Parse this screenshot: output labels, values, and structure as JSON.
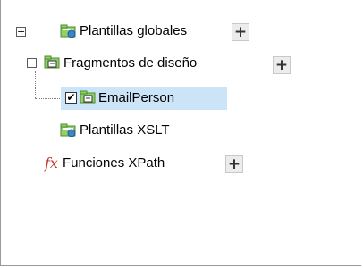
{
  "tree": {
    "nodes": [
      {
        "label": "Plantillas globales",
        "expander": "+",
        "has_add": true
      },
      {
        "label": "Fragmentos de diseño",
        "expander": "−",
        "has_add": true
      },
      {
        "label": "EmailPerson",
        "checked": true,
        "selected": true
      },
      {
        "label": "Plantillas XSLT"
      },
      {
        "label": "Funciones XPath",
        "has_add": true
      }
    ],
    "add_glyph": "+",
    "check_glyph": "✔",
    "fx_glyph": "fx"
  },
  "colors": {
    "selection": "#cce4f7",
    "folder": "#8fd16a",
    "globe": "#3a86c8"
  }
}
